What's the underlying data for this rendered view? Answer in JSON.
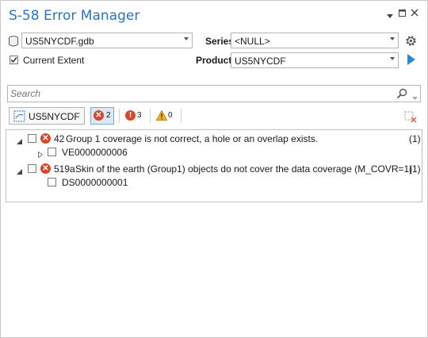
{
  "window": {
    "title": "S-58 Error Manager"
  },
  "source": {
    "database": "US5NYCDF.gdb",
    "current_extent_label": "Current Extent",
    "current_extent_checked": true
  },
  "series": {
    "label": "Series",
    "value": "<NULL>"
  },
  "product": {
    "label": "Product",
    "value": "US5NYCDF"
  },
  "search": {
    "placeholder": "Search"
  },
  "toolbar": {
    "cell_button_label": "US5NYCDF",
    "errors_count": "2",
    "warnings_count": "3",
    "info_count": "0"
  },
  "tree": {
    "items": [
      {
        "code": "42",
        "message": "Group 1 coverage is not correct, a hole or an overlap exists.",
        "count": "(1)",
        "children": [
          {
            "label": "VE0000000006"
          }
        ]
      },
      {
        "code": "519a",
        "message": "Skin of the earth (Group1) objects do not cover the data coverage (M_COVR=1)",
        "count": "(1)",
        "children": [
          {
            "label": "DS0000000001"
          }
        ]
      }
    ]
  },
  "colors": {
    "accent": "#2b73c4",
    "error": "#d9472b",
    "warning": "#e8a400",
    "run": "#2b8ad9"
  }
}
